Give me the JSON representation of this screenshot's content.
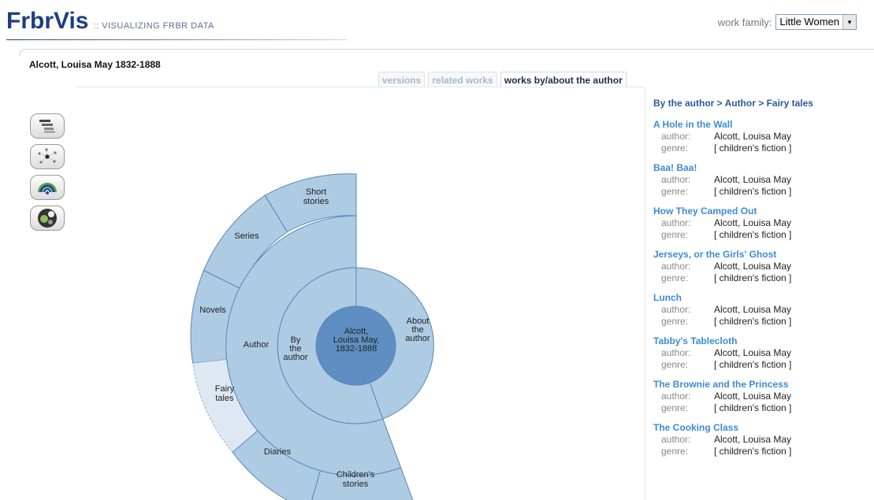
{
  "app": {
    "name": "FrbrVis",
    "tagline": ":: VISUALIZING FRBR DATA"
  },
  "work_family": {
    "label": "work family:",
    "value": "Little Women",
    "arrow": "▾"
  },
  "entity": {
    "title": "Alcott, Louisa May 1832-1888"
  },
  "tabs": [
    {
      "label": "versions",
      "active": false
    },
    {
      "label": "related works",
      "active": false
    },
    {
      "label": "works by/about the author",
      "active": true
    }
  ],
  "tools": [
    {
      "icon": "tree-view-icon"
    },
    {
      "icon": "network-view-icon"
    },
    {
      "icon": "radial-view-icon"
    },
    {
      "icon": "circle-pack-view-icon"
    }
  ],
  "sunburst": {
    "center": "Alcott, Louisa May, 1832-1888",
    "ring1": [
      "By the author",
      "About the author"
    ],
    "ring2": [
      "Author"
    ],
    "ring3": [
      "Short stories",
      "Series",
      "Novels",
      "Fairy tales",
      "Diaries",
      "Children's stories"
    ],
    "selected": "Fairy tales"
  },
  "sidebar": {
    "breadcrumb": "By the author  >  Author  >  Fairy tales",
    "author_key": "author:",
    "genre_key": "genre:",
    "works": [
      {
        "title": "A Hole in the Wall",
        "author": "Alcott, Louisa May",
        "genre": "[ children's fiction ]"
      },
      {
        "title": "Baa! Baa!",
        "author": "Alcott, Louisa May",
        "genre": "[ children's fiction ]"
      },
      {
        "title": "How They Camped Out",
        "author": "Alcott, Louisa May",
        "genre": "[ children's fiction ]"
      },
      {
        "title": "Jerseys, or the Girls' Ghost",
        "author": "Alcott, Louisa May",
        "genre": "[ children's fiction ]"
      },
      {
        "title": "Lunch",
        "author": "Alcott, Louisa May",
        "genre": "[ children's fiction ]"
      },
      {
        "title": "Tabby's Tablecloth",
        "author": "Alcott, Louisa May",
        "genre": "[ children's fiction ]"
      },
      {
        "title": "The Brownie and the Princess",
        "author": "Alcott, Louisa May",
        "genre": "[ children's fiction ]"
      },
      {
        "title": "The Cooking Class",
        "author": "Alcott, Louisa May",
        "genre": "[ children's fiction ]"
      }
    ]
  },
  "colors": {
    "brand": "#1d3f80",
    "center": "#5f8fc2",
    "ring": "#aecbe4",
    "ring_stroke": "#5a86b8",
    "selected": "#dde8f3",
    "link": "#3c8bd6"
  }
}
